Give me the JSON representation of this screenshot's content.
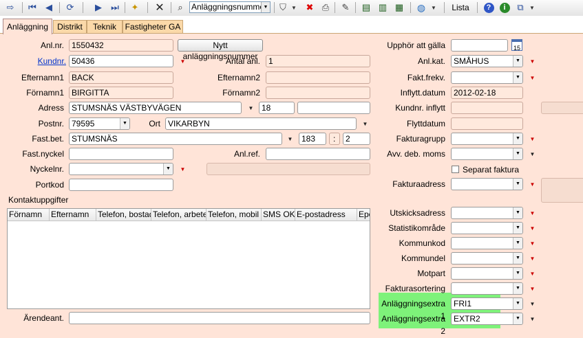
{
  "toolbar": {
    "search_field_value": "Anläggningsnummer",
    "list_label": "Lista"
  },
  "tabs": [
    {
      "label": "Anläggning",
      "active": true
    },
    {
      "label": "Distrikt"
    },
    {
      "label": "Teknik"
    },
    {
      "label": "Fastigheter GA"
    }
  ],
  "form": {
    "anlnr": {
      "label": "Anl.nr.",
      "value": "1550432"
    },
    "new_number_button": "Nytt anläggningsnummer",
    "kundnr": {
      "label": "Kundnr.",
      "value": "50436"
    },
    "antal_anl": {
      "label": "Antal anl.",
      "value": "1"
    },
    "efternamn1": {
      "label": "Efternamn1",
      "value": "BACK"
    },
    "efternamn2": {
      "label": "Efternamn2",
      "value": ""
    },
    "fornamn1": {
      "label": "Förnamn1",
      "value": "BIRGITTA"
    },
    "fornamn2": {
      "label": "Förnamn2",
      "value": ""
    },
    "adress": {
      "label": "Adress",
      "value": "STUMSNÄS VÄSTBYVÄGEN",
      "number": "18",
      "extra": ""
    },
    "postnr": {
      "label": "Postnr.",
      "value": "79595"
    },
    "ort": {
      "label": "Ort",
      "value": "VIKARBYN"
    },
    "fastbet": {
      "label": "Fast.bet.",
      "value": "STUMSNÄS",
      "num1": "183",
      "sep": ":",
      "num2": "2"
    },
    "fastnyckel": {
      "label": "Fast.nyckel",
      "value": ""
    },
    "anlref": {
      "label": "Anl.ref.",
      "value": ""
    },
    "nyckelnr": {
      "label": "Nyckelnr.",
      "value": ""
    },
    "portkod": {
      "label": "Portkod",
      "value": ""
    },
    "kontakt_label": "Kontaktuppgifter",
    "arendeant": {
      "label": "Ärendeant.",
      "value": ""
    }
  },
  "contact_grid": {
    "columns": [
      "Förnamn",
      "Efternamn",
      "Telefon, bostad",
      "Telefon, arbete",
      "Telefon, mobil",
      "SMS OK",
      "E-postadress",
      "Epost"
    ],
    "rows": []
  },
  "right": {
    "upphor": {
      "label": "Upphör att gälla",
      "value": "",
      "cal_day": "15"
    },
    "anlkat": {
      "label": "Anl.kat.",
      "value": "SMÅHUS"
    },
    "faktfrekv": {
      "label": "Fakt.frekv.",
      "value": ""
    },
    "inflyttdatum": {
      "label": "Inflytt.datum",
      "value": "2012-02-18"
    },
    "kundnr_inflytt": {
      "label": "Kundnr. inflytt",
      "value": ""
    },
    "flyttdatum": {
      "label": "Flyttdatum",
      "value": ""
    },
    "fakturagrupp": {
      "label": "Fakturagrupp",
      "value": ""
    },
    "avv_moms": {
      "label": "Avv. deb. moms",
      "value": ""
    },
    "separat_faktura": {
      "label": "Separat faktura",
      "checked": false
    },
    "fakturaadress": {
      "label": "Fakturaadress",
      "value": ""
    },
    "utskicksadress": {
      "label": "Utskicksadress",
      "value": ""
    },
    "statistikomrade": {
      "label": "Statistikområde",
      "value": ""
    },
    "kommunkod": {
      "label": "Kommunkod",
      "value": ""
    },
    "kommundel": {
      "label": "Kommundel",
      "value": ""
    },
    "motpart": {
      "label": "Motpart",
      "value": ""
    },
    "fakturasortering": {
      "label": "Fakturasortering",
      "value": ""
    },
    "extra1": {
      "label": "Anläggningsextra 1",
      "value": "FRI1"
    },
    "extra2": {
      "label": "Anläggningsextra 2",
      "value": "EXTR2"
    }
  },
  "colors": {
    "background": "#ffe4d8",
    "tab": "#fbd9a9",
    "highlight": "#7ef27a",
    "accent_red": "#cc0000"
  }
}
